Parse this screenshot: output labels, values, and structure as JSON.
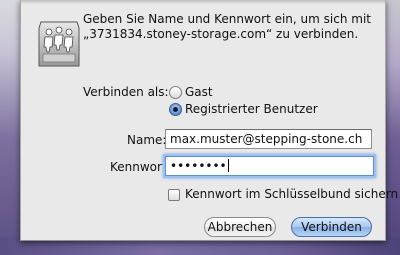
{
  "dialog": {
    "message_line1": "Geben Sie Name und Kennwort ein, um sich mit",
    "message_line2": "„3731834.stoney-storage.com“ zu verbinden."
  },
  "connect_as": {
    "label": "Verbinden als:",
    "options": [
      {
        "label": "Gast",
        "checked": false
      },
      {
        "label": "Registrierter Benutzer",
        "checked": true
      }
    ]
  },
  "name_field": {
    "label": "Name:",
    "value": "max.muster@stepping-stone.ch"
  },
  "password_field": {
    "label": "Kennwort:",
    "value": "••••••••"
  },
  "keychain_checkbox": {
    "label": "Kennwort im Schlüsselbund sichern",
    "checked": false
  },
  "buttons": {
    "cancel": "Abbrechen",
    "connect": "Verbinden"
  },
  "icons": {
    "dialog_icon": "network-share-drive-icon"
  },
  "colors": {
    "primary_button": "#86b1e8",
    "focus_ring": "#7aa7e8",
    "sheet": "#e9e9e9"
  }
}
